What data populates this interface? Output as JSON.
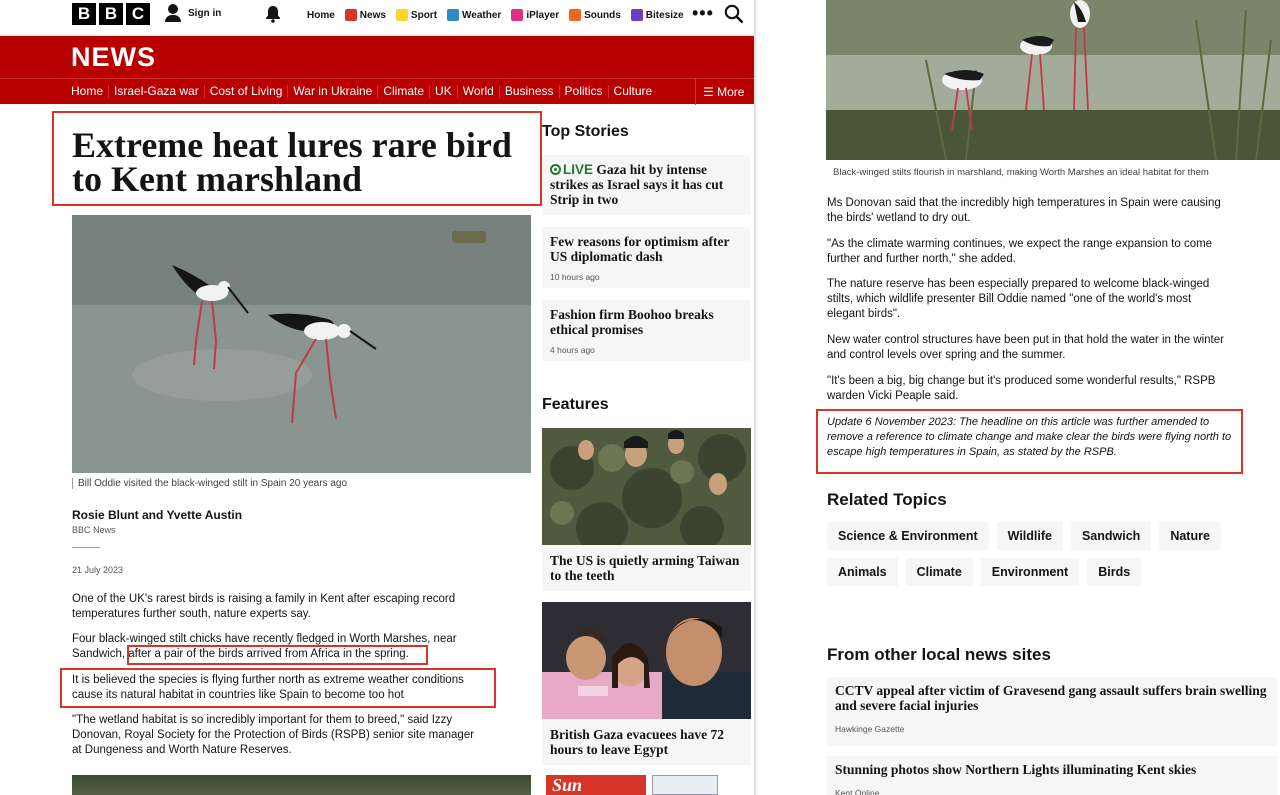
{
  "topbar": {
    "logo_letters": [
      "B",
      "B",
      "C"
    ],
    "sign_in": "Sign in",
    "links": [
      {
        "label": "Home",
        "icon": "",
        "color": ""
      },
      {
        "label": "News",
        "icon": "news-icon",
        "color": "#d8352a"
      },
      {
        "label": "Sport",
        "icon": "sport-icon",
        "color": "#ffd230"
      },
      {
        "label": "Weather",
        "icon": "weather-icon",
        "color": "#2f89c8"
      },
      {
        "label": "iPlayer",
        "icon": "iplayer-icon",
        "color": "#e0307f"
      },
      {
        "label": "Sounds",
        "icon": "sounds-icon",
        "color": "#f26522"
      },
      {
        "label": "Bitesize",
        "icon": "bitesize-icon",
        "color": "#6b3fbf"
      }
    ],
    "more_dots": "•••"
  },
  "brand": {
    "title": "NEWS",
    "accent": "#b80000"
  },
  "section_nav": {
    "items": [
      "Home",
      "Israel-Gaza war",
      "Cost of Living",
      "War in Ukraine",
      "Climate",
      "UK",
      "World",
      "Business",
      "Politics",
      "Culture"
    ],
    "more": "☰ More"
  },
  "article": {
    "headline": "Extreme heat lures rare bird to Kent marshland",
    "hero_caption": "Bill Oddie visited the black-winged stilt in Spain 20 years ago",
    "author": "Rosie Blunt and Yvette Austin",
    "outlet": "BBC News",
    "date": "21 July 2023",
    "paragraphs": [
      "One of the UK's rarest birds is raising a family in Kent after escaping record temperatures further south, nature experts say.",
      "Four black-winged stilt chicks have recently fledged in Worth Marshes, near Sandwich, after a pair of the birds arrived from Africa in the spring.",
      "It is believed the species is flying further north as extreme weather conditions cause its natural habitat in countries like Spain to become too hot",
      "\"The wetland habitat is so incredibly important for them to breed,\" said Izzy Donovan, Royal Society for the Protection of Birds (RSPB) senior site manager at Dungeness and Worth Nature Reserves."
    ]
  },
  "top_stories": {
    "title": "Top Stories",
    "items": [
      {
        "live": "LIVE",
        "text": "Gaza hit by intense strikes as Israel says it has cut Strip in two",
        "ago": ""
      },
      {
        "live": "",
        "text": "Few reasons for optimism after US diplomatic dash",
        "ago": "10 hours ago"
      },
      {
        "live": "",
        "text": "Fashion firm Boohoo breaks ethical promises",
        "ago": "4 hours ago"
      }
    ]
  },
  "features": {
    "title": "Features",
    "items": [
      {
        "text": "The US is quietly arming Taiwan to the teeth"
      },
      {
        "text": "British Gaza evacuees have 72 hours to leave Egypt"
      }
    ],
    "paper_masthead": "Sun"
  },
  "right": {
    "caption": "Black-winged stilts flourish in marshland, making Worth Marshes an ideal habitat for them",
    "paragraphs": [
      "Ms Donovan said that the incredibly high temperatures in Spain were causing the birds' wetland to dry out.",
      "\"As the climate warming continues, we expect the range expansion to come further and further north,\" she added.",
      "The nature reserve has been especially prepared to welcome black-winged stilts, which wildlife presenter Bill Oddie named \"one of the world's most elegant birds\".",
      "New water control structures have been put in that hold the water in the winter and control levels over spring and the summer.",
      "\"It's been a big, big change but it's produced some wonderful results,\" RSPB warden Vicki Peaple said."
    ],
    "update": "Update 6 November 2023: The headline on this article was further amended to remove a reference to climate change and make clear the birds were flying north to escape high temperatures in Spain, as stated by the RSPB.",
    "related_title": "Related Topics",
    "topics": [
      "Science & Environment",
      "Wildlife",
      "Sandwich",
      "Nature",
      "Animals",
      "Climate",
      "Environment",
      "Birds"
    ],
    "local_title": "From other local news sites",
    "local": [
      {
        "text": "CCTV appeal after victim of Gravesend gang assault suffers brain swelling and severe facial injuries",
        "source": "Hawkinge Gazette"
      },
      {
        "text": "Stunning photos show Northern Lights illuminating Kent skies",
        "source": "Kent Online"
      }
    ]
  },
  "highlight_color": "#d8352a"
}
